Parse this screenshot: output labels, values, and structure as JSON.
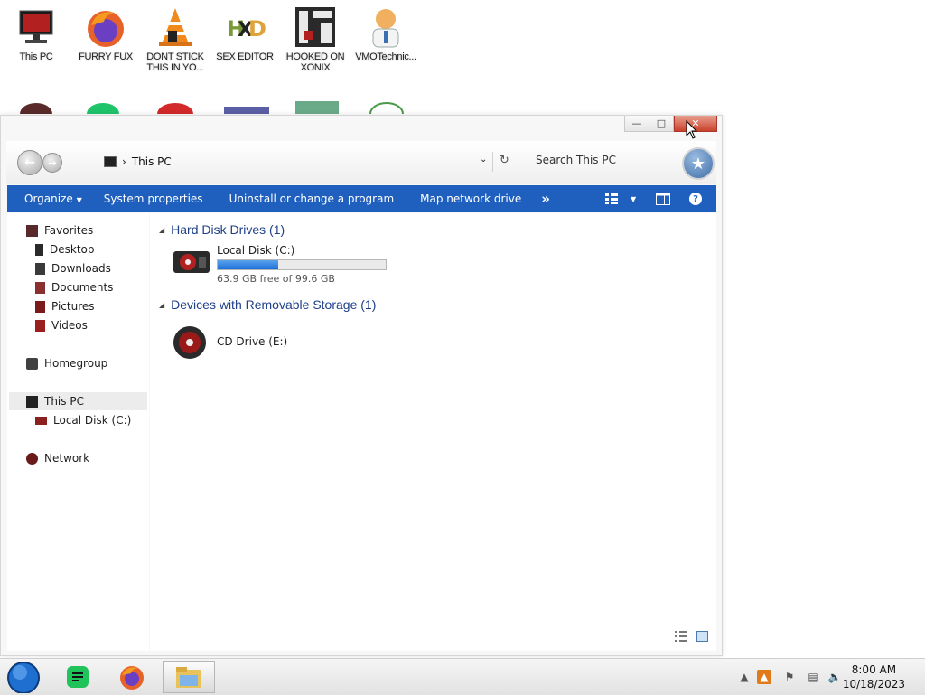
{
  "desktop_icons": [
    {
      "label": "This PC",
      "icon": "computer-icon"
    },
    {
      "label": "FURRY FUX",
      "icon": "firefox-icon"
    },
    {
      "label": "DONT STICK\nTHIS IN YO...",
      "icon": "vlc-cone-icon"
    },
    {
      "label": "SEX EDITOR",
      "icon": "hxd-icon"
    },
    {
      "label": "HOOKED ON\nXONIX",
      "icon": "xonix-game-icon"
    },
    {
      "label": "VMOTechnic...",
      "icon": "doctor-icon"
    }
  ],
  "window": {
    "title_buttons": {
      "minimize": "—",
      "maximize": "□",
      "close": "✕"
    },
    "breadcrumb": "This PC",
    "search_placeholder": "Search This PC"
  },
  "command_bar": {
    "organize": "Organize",
    "system_properties": "System properties",
    "uninstall": "Uninstall or change a program",
    "map_drive": "Map network drive",
    "more": "»"
  },
  "sidebar": {
    "favorites": "Favorites",
    "desktop": "Desktop",
    "downloads": "Downloads",
    "documents": "Documents",
    "pictures": "Pictures",
    "videos": "Videos",
    "homegroup": "Homegroup",
    "this_pc": "This PC",
    "local_disk": "Local Disk (C:)",
    "network": "Network"
  },
  "content": {
    "hdd_group": "Hard Disk Drives (1)",
    "removable_group": "Devices with Removable Storage (1)",
    "local_disk": {
      "name": "Local Disk (C:)",
      "free_text": "63.9 GB free of 99.6 GB",
      "used_fraction": 0.358
    },
    "cd_drive": {
      "name": "CD Drive (E:)"
    }
  },
  "taskbar": {
    "time": "8:00 AM",
    "date": "10/18/2023"
  },
  "colors": {
    "command_bar": "#1f5fbe",
    "accent": "#1c6fd8",
    "close_button": "#c9412b"
  }
}
